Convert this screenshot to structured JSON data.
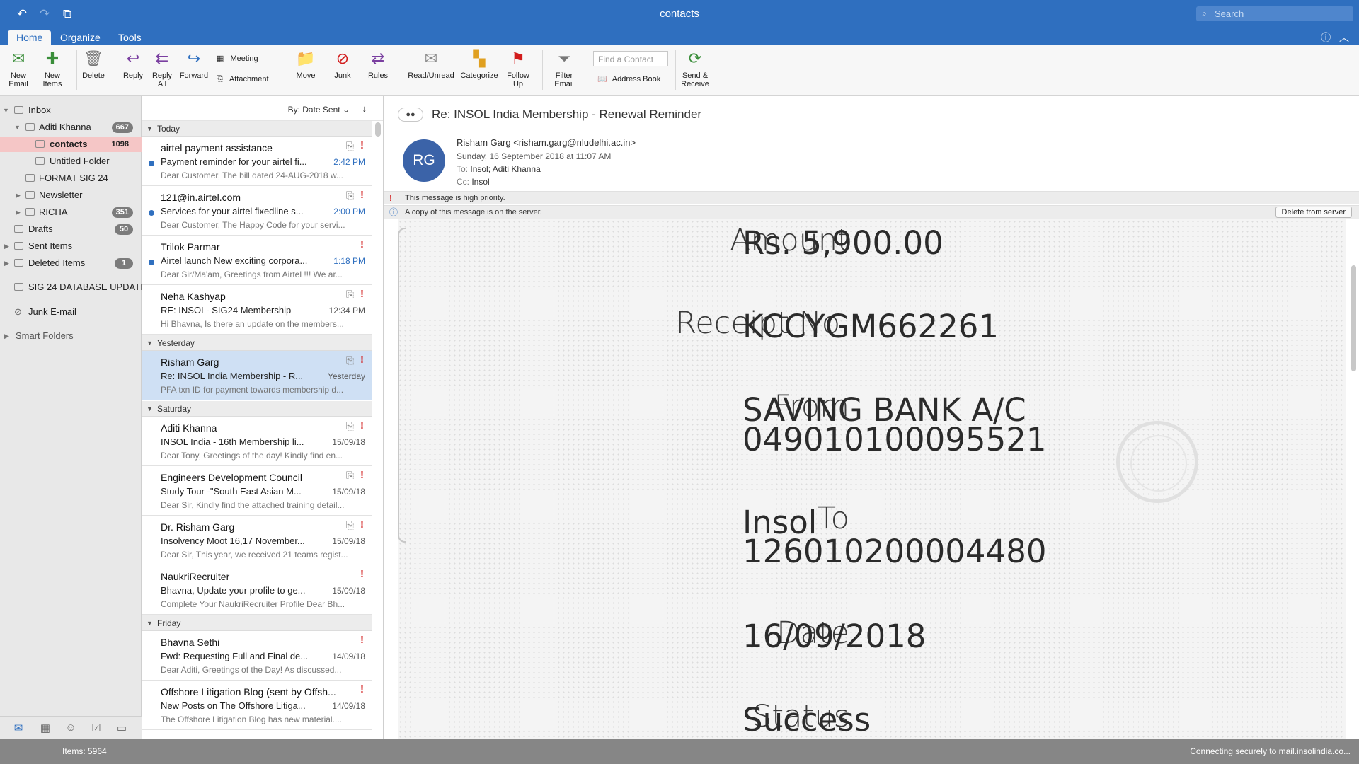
{
  "window": {
    "title": "contacts",
    "search_placeholder": "Search"
  },
  "tabs": [
    {
      "label": "Home",
      "active": true
    },
    {
      "label": "Organize",
      "active": false
    },
    {
      "label": "Tools",
      "active": false
    }
  ],
  "ribbon": {
    "new_email": "New\nEmail",
    "new_items": "New\nItems",
    "delete": "Delete",
    "reply": "Reply",
    "reply_all": "Reply\nAll",
    "forward": "Forward",
    "meeting": "Meeting",
    "attachment": "Attachment",
    "move": "Move",
    "junk": "Junk",
    "rules": "Rules",
    "read_unread": "Read/Unread",
    "categorize": "Categorize",
    "follow_up": "Follow\nUp",
    "filter_email": "Filter\nEmail",
    "find_contact_placeholder": "Find a Contact",
    "address_book": "Address Book",
    "send_receive": "Send &\nReceive"
  },
  "folders": [
    {
      "name": "Inbox",
      "count": ""
    },
    {
      "name": "Aditi Khanna",
      "count": "667"
    },
    {
      "name": "contacts",
      "count": "1098"
    },
    {
      "name": "Untitled Folder",
      "count": ""
    },
    {
      "name": "FORMAT SIG 24",
      "count": ""
    },
    {
      "name": "Newsletter",
      "count": ""
    },
    {
      "name": "RICHA",
      "count": "351"
    },
    {
      "name": "Drafts",
      "count": "50"
    },
    {
      "name": "Sent Items",
      "count": ""
    },
    {
      "name": "Deleted Items",
      "count": "1"
    },
    {
      "name": "SIG 24 DATABASE UPDATI...",
      "count": ""
    },
    {
      "name": "Junk E-mail",
      "count": ""
    },
    {
      "name": "Smart Folders",
      "count": ""
    }
  ],
  "sort": {
    "label": "By: Date Sent"
  },
  "groups": [
    "Today",
    "Yesterday",
    "Saturday",
    "Friday"
  ],
  "messages": [
    {
      "sender": "airtel payment assistance",
      "subject": "Payment reminder for your airtel fi...",
      "time": "2:42 PM",
      "preview": "Dear Customer, The bill dated 24-AUG-2018 w..."
    },
    {
      "sender": "121@in.airtel.com",
      "subject": "Services for your airtel fixedline s...",
      "time": "2:00 PM",
      "preview": "Dear Customer, The Happy Code for your servi..."
    },
    {
      "sender": "Trilok Parmar",
      "subject": "Airtel launch New exciting corpora...",
      "time": "1:18 PM",
      "preview": "Dear Sir/Ma'am, Greetings from Airtel !!! We ar..."
    },
    {
      "sender": "Neha Kashyap",
      "subject": "RE: INSOL- SIG24 Membership",
      "time": "12:34 PM",
      "preview": "Hi Bhavna, Is there an update on the members..."
    },
    {
      "sender": "Risham Garg",
      "subject": "Re: INSOL India Membership - R...",
      "time": "Yesterday",
      "preview": "PFA txn ID for payment towards membership d..."
    },
    {
      "sender": "Aditi Khanna",
      "subject": "INSOL India - 16th Membership li...",
      "time": "15/09/18",
      "preview": "Dear Tony, Greetings of the day! Kindly find en..."
    },
    {
      "sender": "Engineers Development Council",
      "subject": "Study Tour -\"South East Asian M...",
      "time": "15/09/18",
      "preview": "Dear Sir, Kindly find the attached training detail..."
    },
    {
      "sender": "Dr. Risham Garg",
      "subject": "Insolvency Moot 16,17 November...",
      "time": "15/09/18",
      "preview": "Dear Sir, This year, we received 21 teams regist..."
    },
    {
      "sender": "NaukriRecruiter",
      "subject": "Bhavna, Update your profile to ge...",
      "time": "15/09/18",
      "preview": "Complete Your NaukriRecruiter Profile Dear Bh..."
    },
    {
      "sender": "Bhavna Sethi",
      "subject": "Fwd: Requesting Full and Final de...",
      "time": "14/09/18",
      "preview": "Dear Aditi, Greetings of the Day! As discussed..."
    },
    {
      "sender": "Offshore Litigation Blog (sent by Offsh...",
      "subject": "New Posts on The Offshore Litiga...",
      "time": "14/09/18",
      "preview": "The Offshore Litigation Blog has new material...."
    }
  ],
  "reading": {
    "subject": "Re: INSOL India Membership - Renewal Reminder",
    "avatar": "RG",
    "from": "Risham Garg <risham.garg@nludelhi.ac.in>",
    "date": "Sunday, 16 September 2018 at 11:07 AM",
    "to_label": "To:",
    "to": "Insol;   Aditi Khanna",
    "cc_label": "Cc:",
    "cc": "Insol",
    "priority_note": "This message is high priority.",
    "server_note": "A copy of this message is on the server.",
    "delete_server": "Delete from server"
  },
  "receipt": {
    "amount_label": "Amount",
    "amount": "Rs. 5,900.00",
    "receipt_label": "Receipt No.",
    "receipt_no": "KCCYGM662261",
    "from_label": "From",
    "from_1": "SAVING BANK A/C",
    "from_2": "049010100095521",
    "to_label": "To",
    "to_1": "Insol",
    "to_2": "126010200004480",
    "date_label": "Date",
    "date": "16/09/2018",
    "status_label": "Status",
    "status": "Success"
  },
  "status": {
    "items": "Items: 5964",
    "connection": "Connecting securely to mail.insolindia.co..."
  },
  "colors": {
    "accent": "#2f6fbf",
    "selected_folder": "#f5c6c6",
    "selected_message": "#cfe0f4",
    "importance": "#d21c1c"
  }
}
